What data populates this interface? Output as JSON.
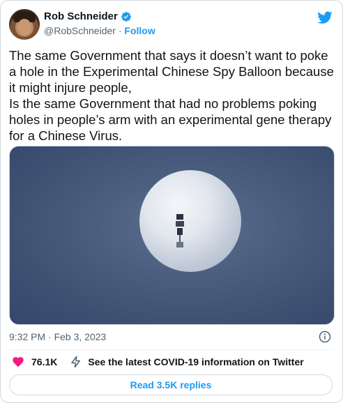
{
  "author": {
    "name": "Rob Schneider",
    "handle": "@RobSchneider",
    "separator": "·",
    "follow_label": "Follow",
    "verified_icon": "verified-badge-icon"
  },
  "brand": {
    "logo_icon": "twitter-bird-icon",
    "accent_color": "#1d9bf0"
  },
  "tweet": {
    "text": "The same Government that says it doesn’t want to poke a hole in the Experimental Chinese Spy Balloon because it might injure people,\nIs the same Government that had no problems poking holes in people’s arm with an experimental gene therapy for a Chinese Virus.",
    "media_icon": "balloon-photo"
  },
  "meta": {
    "timestamp": "9:32 PM · Feb 3, 2023",
    "info_icon": "info-icon"
  },
  "actions": {
    "likes_count": "76.1K",
    "like_icon": "heart-icon",
    "covid_icon": "lightning-icon",
    "covid_link": "See the latest COVID-19 information on Twitter"
  },
  "replies": {
    "label": "Read 3.5K replies"
  },
  "colors": {
    "like": "#f91880",
    "text_secondary": "#536471"
  }
}
